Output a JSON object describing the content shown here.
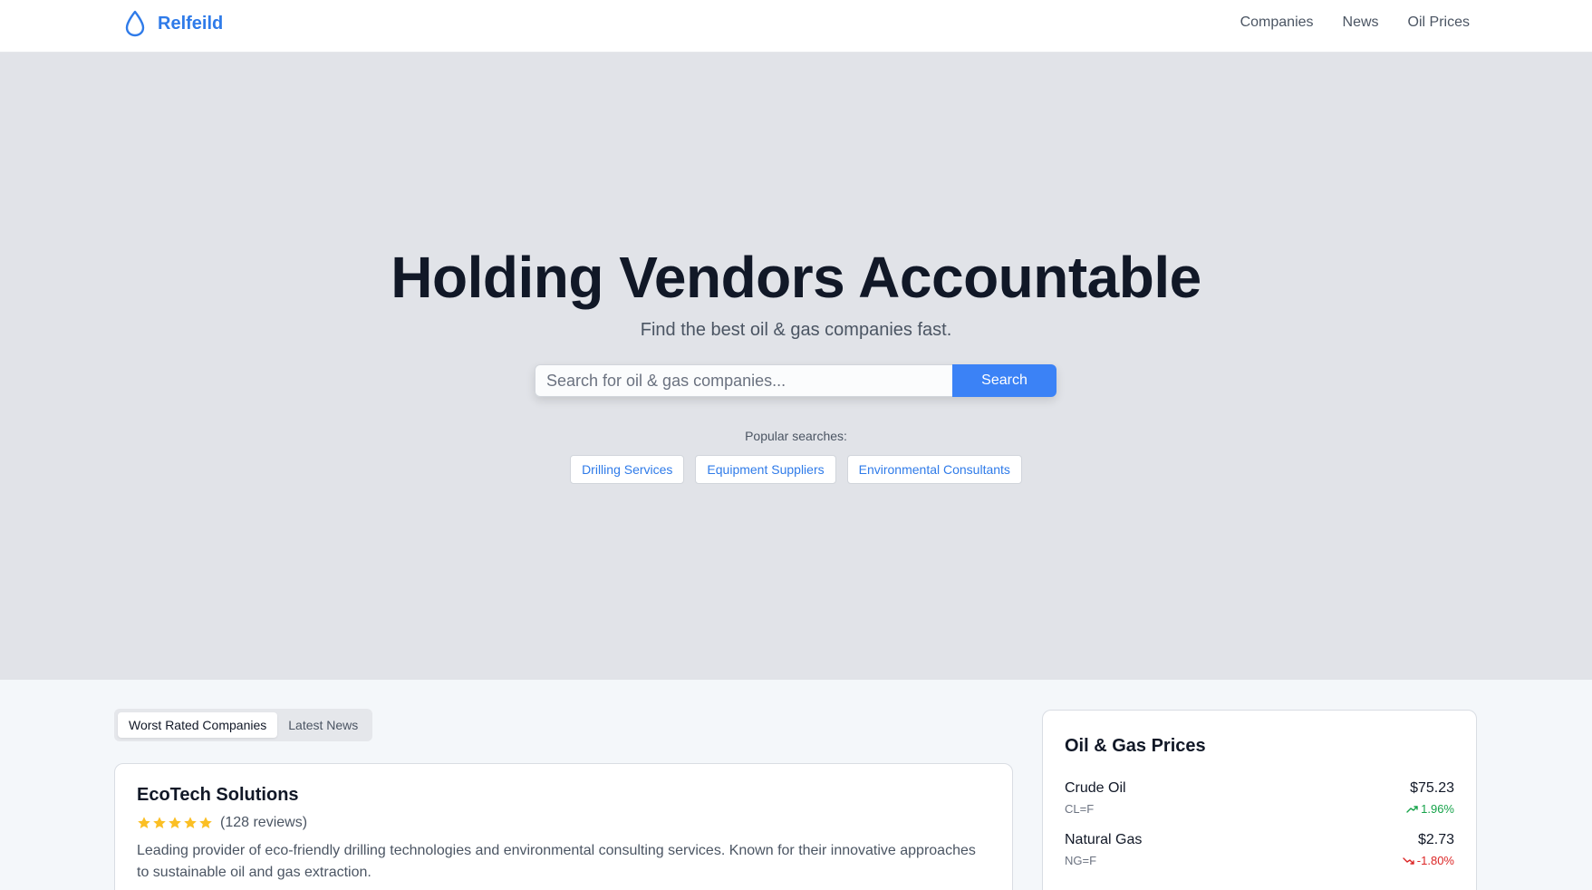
{
  "header": {
    "brand_name": "Relfeild",
    "nav": [
      "Companies",
      "News",
      "Oil Prices"
    ]
  },
  "hero": {
    "title": "Holding Vendors Accountable",
    "subtitle": "Find the best oil & gas companies fast.",
    "search_placeholder": "Search for oil & gas companies...",
    "search_button": "Search",
    "popular_label": "Popular searches:",
    "popular": [
      "Drilling Services",
      "Equipment Suppliers",
      "Environmental Consultants"
    ]
  },
  "tabs": [
    "Worst Rated Companies",
    "Latest News"
  ],
  "company": {
    "name": "EcoTech Solutions",
    "rating": 5,
    "reviews": "(128 reviews)",
    "description": "Leading provider of eco-friendly drilling technologies and environmental consulting services. Known for their innovative approaches to sustainable oil and gas extraction."
  },
  "prices": {
    "title": "Oil & Gas Prices",
    "items": [
      {
        "name": "Crude Oil",
        "symbol": "CL=F",
        "price": "$75.23",
        "change": "1.96%",
        "direction": "up"
      },
      {
        "name": "Natural Gas",
        "symbol": "NG=F",
        "price": "$2.73",
        "change": "-1.80%",
        "direction": "down"
      }
    ]
  },
  "colors": {
    "accent": "#3b82f6",
    "brand": "#2f7be9",
    "up": "#16a34a",
    "down": "#dc2626",
    "star": "#fbbf24"
  }
}
